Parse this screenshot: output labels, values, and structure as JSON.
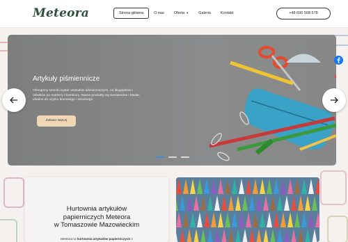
{
  "header": {
    "logo": "Meteora",
    "nav": [
      {
        "label": "Strona główna"
      },
      {
        "label": "O nas"
      },
      {
        "label": "Oferta"
      },
      {
        "label": "Galeria"
      },
      {
        "label": "Kontakt"
      }
    ],
    "phone": "+48 690 508 578"
  },
  "hero": {
    "title": "Artykuły piśmiennicze",
    "description": "Oferujemy szeroki wybór artykułów piśmienniczych, od długopisów i ołówków po markery i korektory. Nasze produkty są niezawodne i trwałe, idealne do użytku biurowego i szkolnego.",
    "button": "Zobacz więcej",
    "slides": 3,
    "active_slide": 1
  },
  "intro": {
    "title_line1": "Hurtownia artykułów",
    "title_line2": "papierniczych Meteora",
    "title_line3": "w Tomaszowie Mazowieckim",
    "text_prefix": "Meteora to ",
    "text_bold": "hurtownia artykułów papierniczych",
    "text_suffix": " z"
  },
  "colors": {
    "brand": "#2f4f3a",
    "button": "#f1d7b6",
    "dot_active": "#3f8ad8",
    "facebook": "#1877f2"
  }
}
